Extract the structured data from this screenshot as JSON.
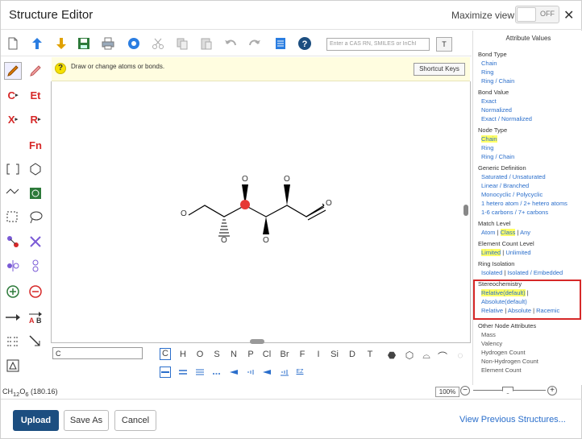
{
  "window": {
    "title": "Structure Editor",
    "maximize_label": "Maximize view",
    "toggle_state": "OFF",
    "close_glyph": "✕"
  },
  "toolbar": {
    "search_placeholder": "Enter a CAS RN, SMILES or InChI",
    "search_button": "T",
    "icons": [
      "new-icon",
      "import-icon",
      "export-icon",
      "save-icon",
      "print-icon",
      "clean-icon",
      "cut-icon",
      "copy-icon",
      "paste-icon",
      "undo-icon",
      "redo-icon",
      "template-icon",
      "help-icon"
    ]
  },
  "hint": {
    "text": "Draw or change atoms or bonds.",
    "shortcut_label": "Shortcut Keys"
  },
  "left_tools": {
    "c_label": "C",
    "et_label": "Et",
    "x_label": "X",
    "r_label": "R",
    "fn_label": "Fn"
  },
  "molecule": {
    "atom_label": "O"
  },
  "element_bar": {
    "input_value": "C",
    "elements": [
      "C",
      "H",
      "O",
      "S",
      "N",
      "P",
      "Cl",
      "Br",
      "F",
      "I",
      "Si",
      "D",
      "T"
    ],
    "selected": "C",
    "bonds": [
      "single",
      "double",
      "triple",
      "dashed",
      "wedge-bold",
      "wedge-hash",
      "wedge-both",
      "hash-both",
      "ez"
    ],
    "ez_label": "EZ"
  },
  "footer": {
    "formula_prefix": "C",
    "formula_h": "H",
    "formula_h_count": "12",
    "formula_o": "O",
    "formula_o_count": "6",
    "mass": " (180.16)",
    "zoom": "100%",
    "zoom_minus": "−",
    "zoom_plus": "+"
  },
  "actions": {
    "upload": "Upload",
    "save_as": "Save As",
    "cancel": "Cancel",
    "view_previous": "View Previous Structures..."
  },
  "attributes": {
    "title": "Attribute Values",
    "bond_type": {
      "label": "Bond Type",
      "items": [
        "Chain",
        "Ring",
        "Ring / Chain"
      ]
    },
    "bond_value": {
      "label": "Bond Value",
      "items": [
        "Exact",
        "Normalized",
        "Exact / Normalized"
      ]
    },
    "node_type": {
      "label": "Node Type",
      "items": [
        "Chain",
        "Ring",
        "Ring / Chain"
      ]
    },
    "generic_definition": {
      "label": "Generic Definition",
      "items": [
        "Saturated / Unsaturated",
        "Linear / Branched",
        "Monocyclic / Polycyclic",
        "1 hetero atom / 2+ hetero atoms",
        "1-6 carbons / 7+ carbons"
      ]
    },
    "match_level": {
      "label": "Match Level",
      "atom": "Atom",
      "class": "Class",
      "any": "Any",
      "sep": " | "
    },
    "element_count": {
      "label": "Element Count Level",
      "limited": "Limited",
      "unlimited": "Unlimited",
      "sep": " | "
    },
    "ring_isolation": {
      "label": "Ring Isolation",
      "isolated": "Isolated",
      "isolated_embedded": "Isolated / Embedded",
      "sep": " | "
    },
    "stereochemistry": {
      "label": "Stereochemistry",
      "relative_default": "Relative(default)",
      "absolute_default": "Absolute(default)",
      "relative": "Relative",
      "absolute": "Absolute",
      "racemic": "Racemic",
      "sep": " | ",
      "trailing_sep": " |"
    },
    "other": {
      "label": "Other Node Attributes",
      "items": [
        "Mass",
        "Valency",
        "Hydrogen Count",
        "Non-Hydrogen Count",
        "Element Count"
      ]
    }
  }
}
